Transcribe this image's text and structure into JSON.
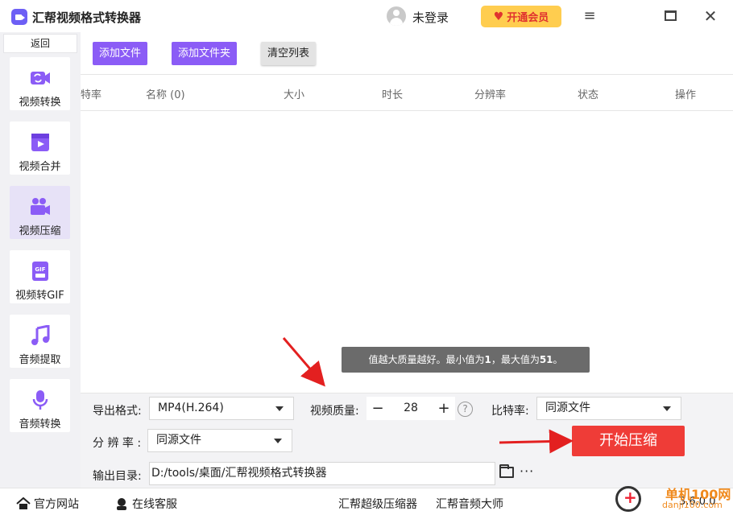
{
  "titlebar": {
    "app_title": "汇帮视频格式转换器",
    "login_text": "未登录",
    "vip_label": "开通会员",
    "menu_icon": "≡",
    "close_icon": "✕"
  },
  "sidebar": {
    "back_label": "返回",
    "items": [
      {
        "label": "视频转换",
        "icon": "video-convert-icon",
        "active": false
      },
      {
        "label": "视频合并",
        "icon": "video-merge-icon",
        "active": false
      },
      {
        "label": "视频压缩",
        "icon": "video-compress-icon",
        "active": true
      },
      {
        "label": "视频转GIF",
        "icon": "gif-icon",
        "active": false
      },
      {
        "label": "音频提取",
        "icon": "music-note-icon",
        "active": false
      },
      {
        "label": "音频转换",
        "icon": "microphone-icon",
        "active": false
      }
    ]
  },
  "toolbar": {
    "add_file": "添加文件",
    "add_folder": "添加文件夹",
    "clear_list": "清空列表"
  },
  "table": {
    "columns": [
      "特率",
      "名称 (0)",
      "大小",
      "时长",
      "分辨率",
      "状态",
      "操作"
    ]
  },
  "tooltip": {
    "prefix": "值越大质量越好。最小值为",
    "min": "1",
    "middle": "，最大值为",
    "max": "51",
    "suffix": "。"
  },
  "settings": {
    "format_label": "导出格式:",
    "format_value": "MP4(H.264)",
    "quality_label": "视频质量:",
    "quality_minus": "−",
    "quality_value": "28",
    "quality_plus": "+",
    "help": "?",
    "bitrate_label": "比特率:",
    "bitrate_value": "同源文件",
    "resolution_label": "分 辨 率 :",
    "resolution_value": "同源文件",
    "start_button": "开始压缩",
    "output_label": "输出目录:",
    "output_path": "D:/tools/桌面/汇帮视频格式转换器",
    "more": "···"
  },
  "footer": {
    "website": "官方网站",
    "support": "在线客服",
    "link1": "汇帮超级压缩器",
    "link2": "汇帮音频大师",
    "version": "3.6.0.0"
  },
  "watermark": {
    "text": "单机100网",
    "sub": "danji100.com"
  },
  "colors": {
    "accent_purple": "#8b5cf6",
    "start_red": "#ef3c37",
    "vip_yellow": "#ffcd4f",
    "arrow_red": "#e32020"
  }
}
